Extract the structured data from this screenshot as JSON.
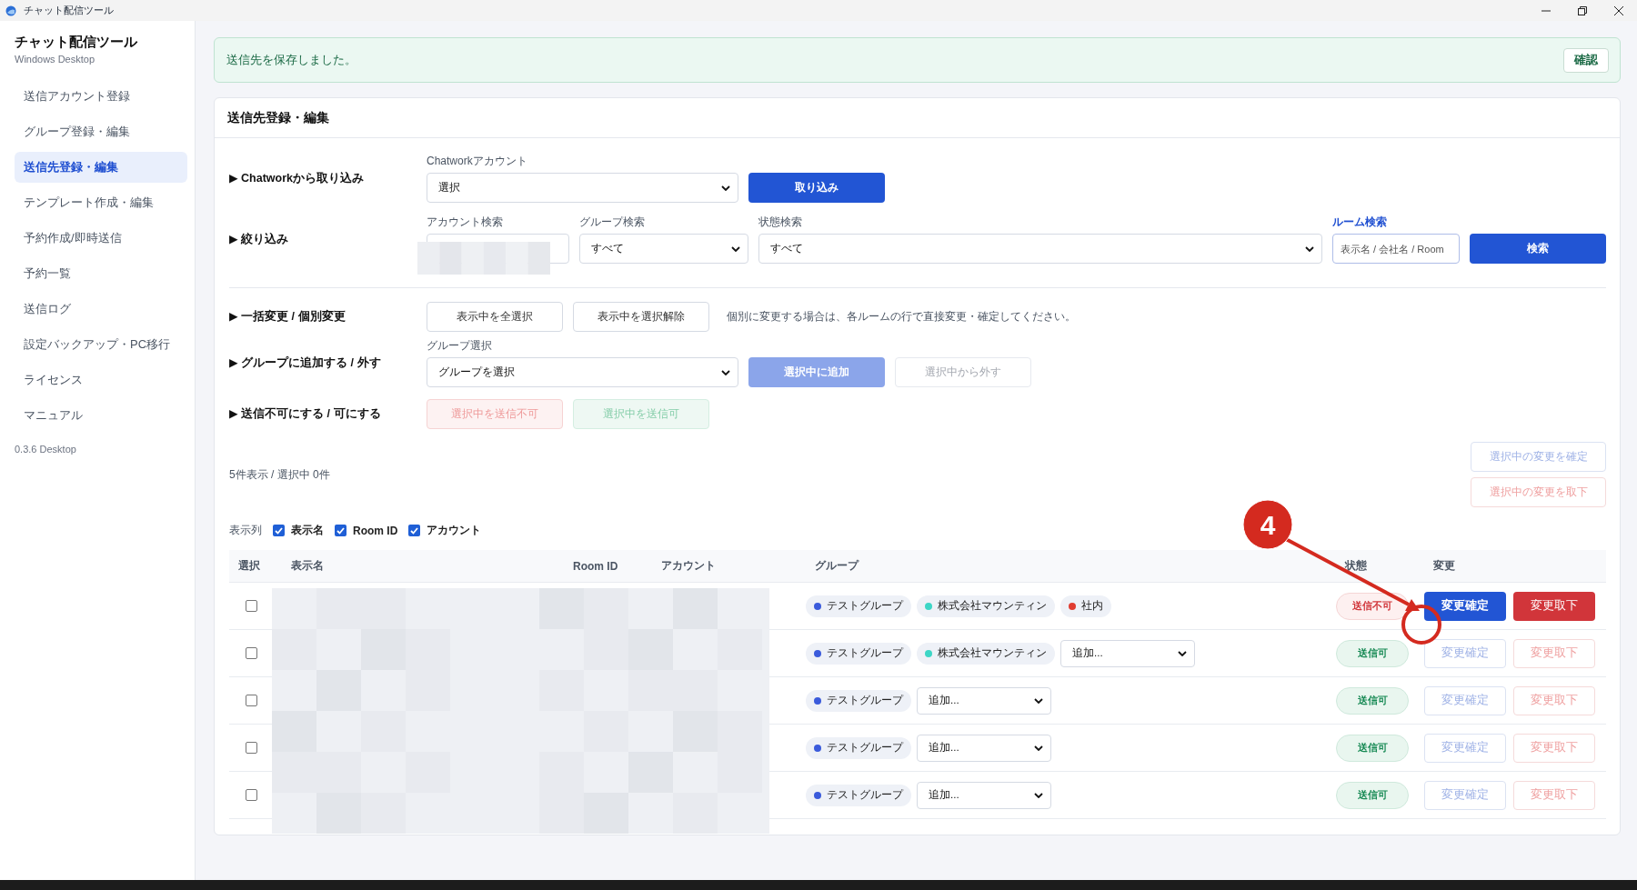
{
  "window": {
    "title": "チャット配信ツール"
  },
  "sidebar": {
    "app_name": "チャット配信ツール",
    "subtitle": "Windows Desktop",
    "items": [
      {
        "label": "送信アカウント登録",
        "selected": false
      },
      {
        "label": "グループ登録・編集",
        "selected": false
      },
      {
        "label": "送信先登録・編集",
        "selected": true
      },
      {
        "label": "テンプレート作成・編集",
        "selected": false
      },
      {
        "label": "予約作成/即時送信",
        "selected": false
      },
      {
        "label": "予約一覧",
        "selected": false
      },
      {
        "label": "送信ログ",
        "selected": false
      },
      {
        "label": "設定バックアップ・PC移行",
        "selected": false
      },
      {
        "label": "ライセンス",
        "selected": false
      },
      {
        "label": "マニュアル",
        "selected": false
      }
    ],
    "version": "0.3.6 Desktop"
  },
  "notice": {
    "message": "送信先を保存しました。",
    "button": "確認"
  },
  "card": {
    "title": "送信先登録・編集",
    "import": {
      "label": "▶ Chatworkから取り込み",
      "caption": "Chatworkアカウント",
      "value": "選択",
      "button": "取り込み"
    },
    "filter": {
      "label": "▶ 絞り込み",
      "fields": [
        {
          "kind": "redacted",
          "caption": "アカウント検索"
        },
        {
          "kind": "select",
          "caption": "グループ検索",
          "value": "すべて"
        },
        {
          "kind": "select",
          "caption": "状態検索",
          "value": "すべて"
        },
        {
          "kind": "input",
          "caption": "ルーム検索",
          "placeholder": "表示名 / 会社名 / Room",
          "focused": true
        }
      ],
      "button": "検索"
    },
    "bulk": {
      "label": "▶ 一括変更 / 個別変更",
      "buttons": [
        {
          "label": "表示中を全選択",
          "kind": "default",
          "disabled": false
        },
        {
          "label": "表示中を選択解除",
          "kind": "default",
          "disabled": false
        }
      ],
      "note": "個別に変更する場合は、各ルームの行で直接変更・確定してください。"
    },
    "group_edit": {
      "label": "▶ グループに追加する / 外す",
      "caption": "グループ選択",
      "value": "グループを選択",
      "buttons": [
        {
          "label": "選択中に追加",
          "kind": "primary",
          "disabled": true
        },
        {
          "label": "選択中から外す",
          "kind": "default",
          "disabled": true
        }
      ]
    },
    "sendable": {
      "label": "▶ 送信不可にする / 可にする",
      "buttons": [
        {
          "label": "選択中を送信不可",
          "kind": "danger",
          "disabled": true
        },
        {
          "label": "選択中を送信可",
          "kind": "success",
          "disabled": true
        }
      ]
    },
    "count": "5件表示 / 選択中 0件",
    "selection_actions": [
      {
        "label": "選択中の変更を確定",
        "kind": "outline-primary",
        "disabled": true
      },
      {
        "label": "選択中の変更を取下",
        "kind": "outline-danger",
        "disabled": true
      }
    ],
    "columns_toggle": {
      "label": "表示列",
      "options": [
        {
          "label": "表示名",
          "checked": true
        },
        {
          "label": "Room ID",
          "checked": true
        },
        {
          "label": "アカウント",
          "checked": true
        }
      ]
    },
    "table": {
      "columns": [
        "選択",
        "表示名",
        "Room ID",
        "アカウント",
        "グループ",
        "状態",
        "変更"
      ],
      "rows": [
        {
          "selected": false,
          "groups": [
            {
              "name": "テストグループ",
              "color": "#3b5bdb"
            },
            {
              "name": "株式会社マウンティン",
              "color": "#3dd6c6"
            },
            {
              "name": "社内",
              "color": "#e03c31"
            }
          ],
          "status": {
            "label": "送信不可",
            "kind": "ng"
          },
          "actions": [
            {
              "label": "変更確定",
              "kind": "primary",
              "disabled": false
            },
            {
              "label": "変更取下",
              "kind": "danger",
              "disabled": false
            }
          ]
        },
        {
          "selected": false,
          "groups": [
            {
              "name": "テストグループ",
              "color": "#3b5bdb"
            },
            {
              "name": "株式会社マウンティン",
              "color": "#3dd6c6"
            }
          ],
          "add_value": "追加...",
          "status": {
            "label": "送信可",
            "kind": "ok"
          },
          "actions": [
            {
              "label": "変更確定",
              "kind": "outline-primary",
              "disabled": true
            },
            {
              "label": "変更取下",
              "kind": "outline-danger",
              "disabled": true
            }
          ]
        },
        {
          "selected": false,
          "groups": [
            {
              "name": "テストグループ",
              "color": "#3b5bdb"
            }
          ],
          "add_value": "追加...",
          "status": {
            "label": "送信可",
            "kind": "ok"
          },
          "actions": [
            {
              "label": "変更確定",
              "kind": "outline-primary",
              "disabled": true
            },
            {
              "label": "変更取下",
              "kind": "outline-danger",
              "disabled": true
            }
          ]
        },
        {
          "selected": false,
          "groups": [
            {
              "name": "テストグループ",
              "color": "#3b5bdb"
            }
          ],
          "add_value": "追加...",
          "status": {
            "label": "送信可",
            "kind": "ok"
          },
          "actions": [
            {
              "label": "変更確定",
              "kind": "outline-primary",
              "disabled": true
            },
            {
              "label": "変更取下",
              "kind": "outline-danger",
              "disabled": true
            }
          ]
        },
        {
          "selected": false,
          "groups": [
            {
              "name": "テストグループ",
              "color": "#3b5bdb"
            }
          ],
          "add_value": "追加...",
          "status": {
            "label": "送信可",
            "kind": "ok"
          },
          "actions": [
            {
              "label": "変更確定",
              "kind": "outline-primary",
              "disabled": true
            },
            {
              "label": "変更取下",
              "kind": "outline-danger",
              "disabled": true
            }
          ]
        }
      ]
    }
  },
  "annotation": {
    "number": "4"
  }
}
